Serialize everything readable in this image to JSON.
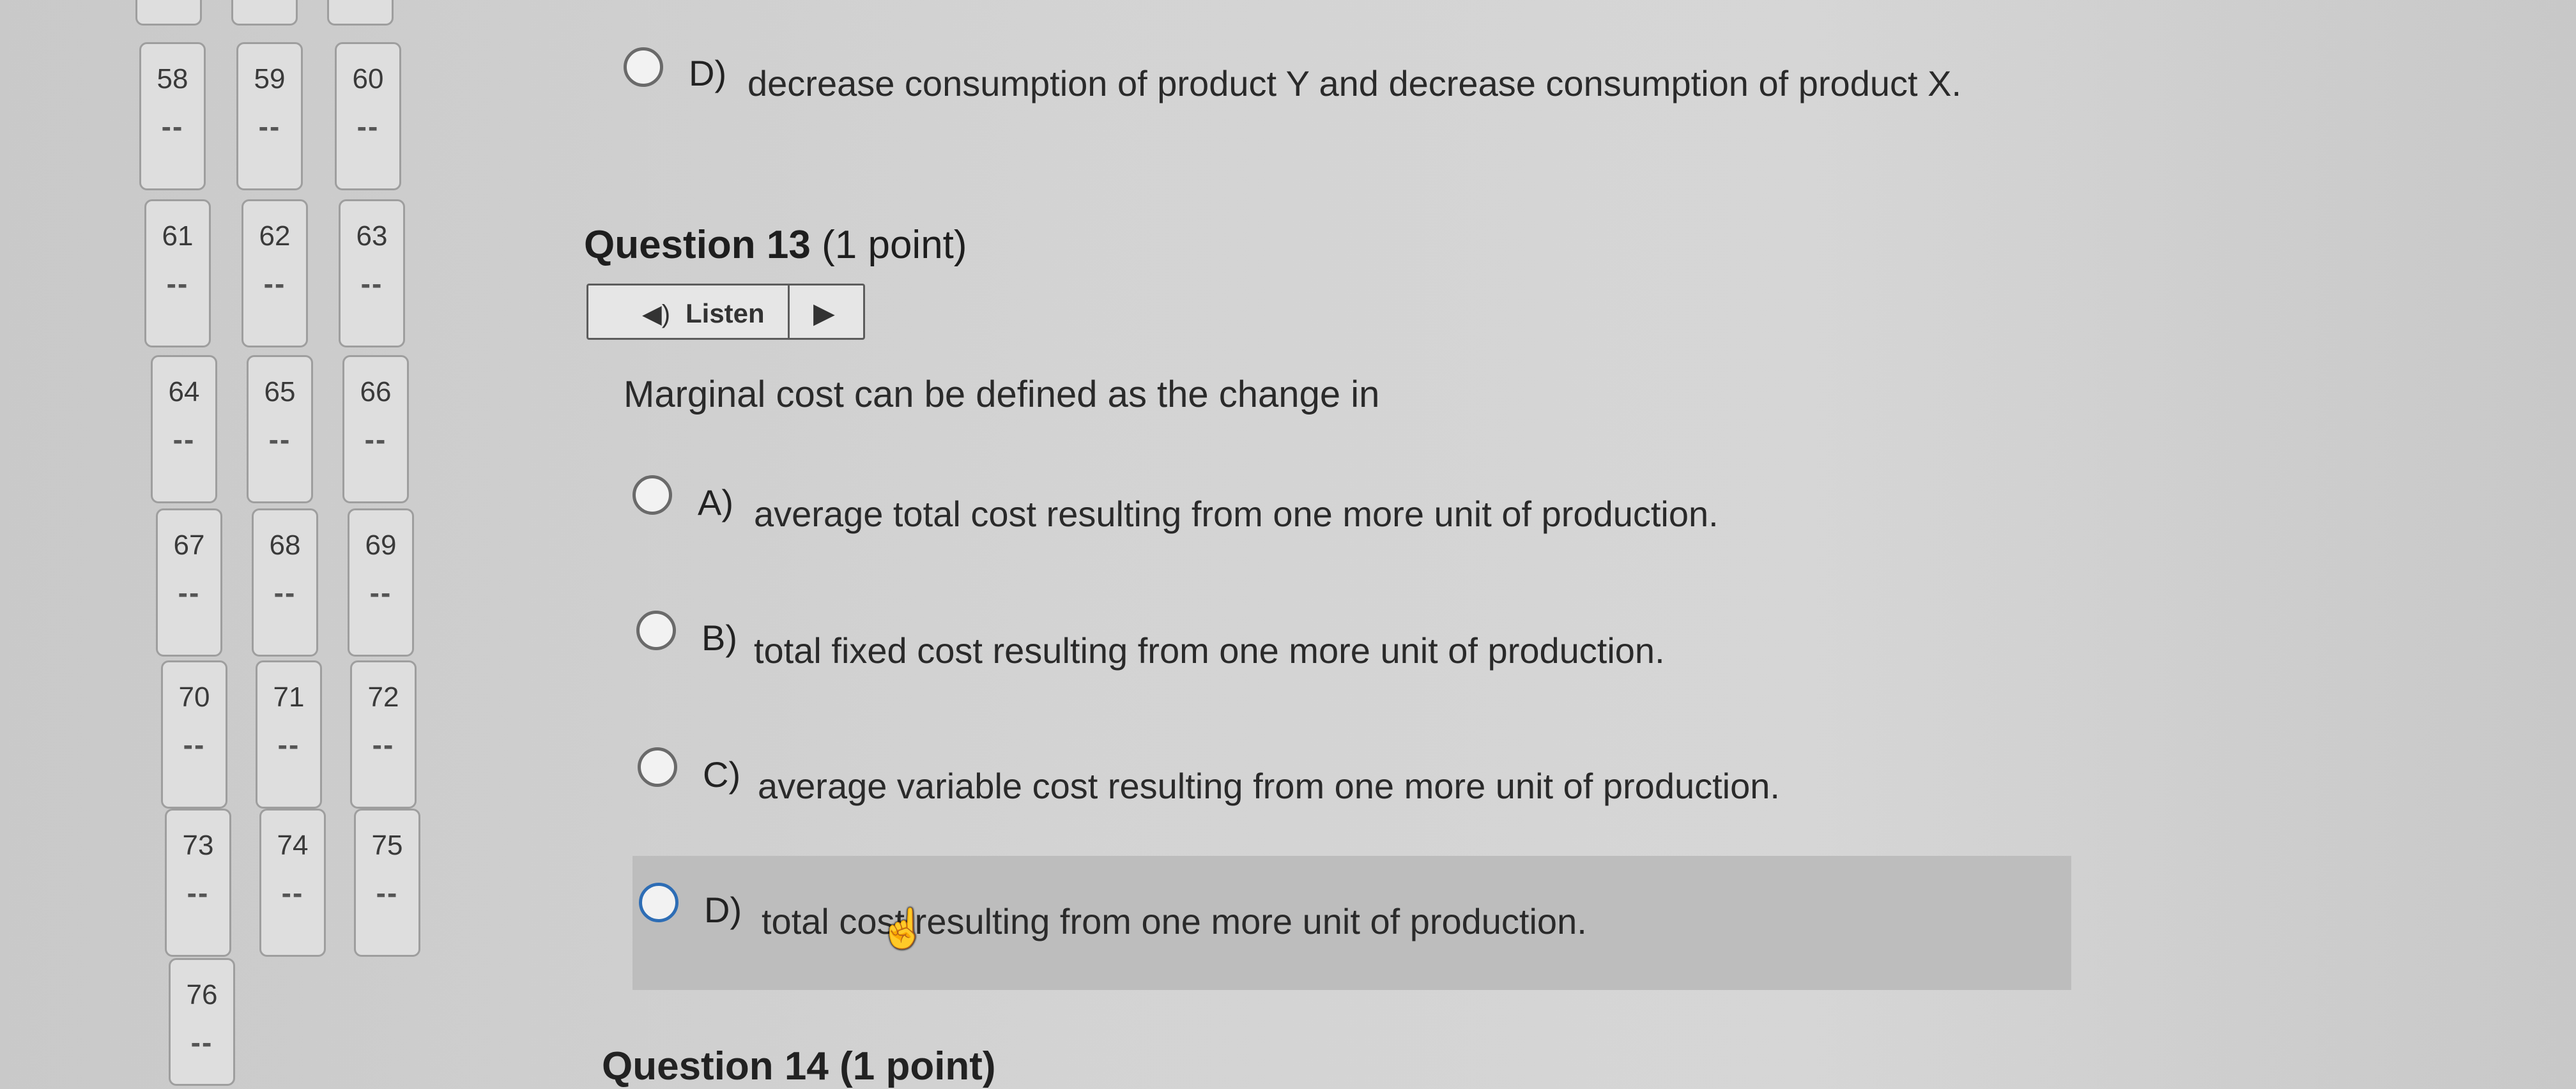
{
  "sidebar": {
    "questions": [
      {
        "number": "58",
        "status": "--"
      },
      {
        "number": "59",
        "status": "--"
      },
      {
        "number": "60",
        "status": "--"
      },
      {
        "number": "61",
        "status": "--"
      },
      {
        "number": "62",
        "status": "--"
      },
      {
        "number": "63",
        "status": "--"
      },
      {
        "number": "64",
        "status": "--"
      },
      {
        "number": "65",
        "status": "--"
      },
      {
        "number": "66",
        "status": "--"
      },
      {
        "number": "67",
        "status": "--"
      },
      {
        "number": "68",
        "status": "--"
      },
      {
        "number": "69",
        "status": "--"
      },
      {
        "number": "70",
        "status": "--"
      },
      {
        "number": "71",
        "status": "--"
      },
      {
        "number": "72",
        "status": "--"
      },
      {
        "number": "73",
        "status": "--"
      },
      {
        "number": "74",
        "status": "--"
      },
      {
        "number": "75",
        "status": "--"
      },
      {
        "number": "76",
        "status": "--"
      }
    ]
  },
  "prev_question": {
    "choice_d": {
      "letter": "D)",
      "text": "decrease consumption of product Y and decrease consumption of product X."
    }
  },
  "question13": {
    "title_bold": "Question 13",
    "title_points": "(1 point)",
    "listen_label": "Listen",
    "stem": "Marginal cost can be defined as the change in",
    "choices": [
      {
        "letter": "A)",
        "text": "average total cost resulting from one more unit of production."
      },
      {
        "letter": "B)",
        "text": "total fixed cost resulting from one more unit of production."
      },
      {
        "letter": "C)",
        "text": "average variable cost resulting from one more unit of production."
      },
      {
        "letter": "D)",
        "text": "total cost resulting from one more unit of production."
      }
    ]
  },
  "next_question": {
    "title": "Question 14 (1 point)"
  },
  "icons": {
    "speaker": "speaker-icon",
    "play": "play-icon",
    "cursor": "hand-cursor-icon"
  }
}
